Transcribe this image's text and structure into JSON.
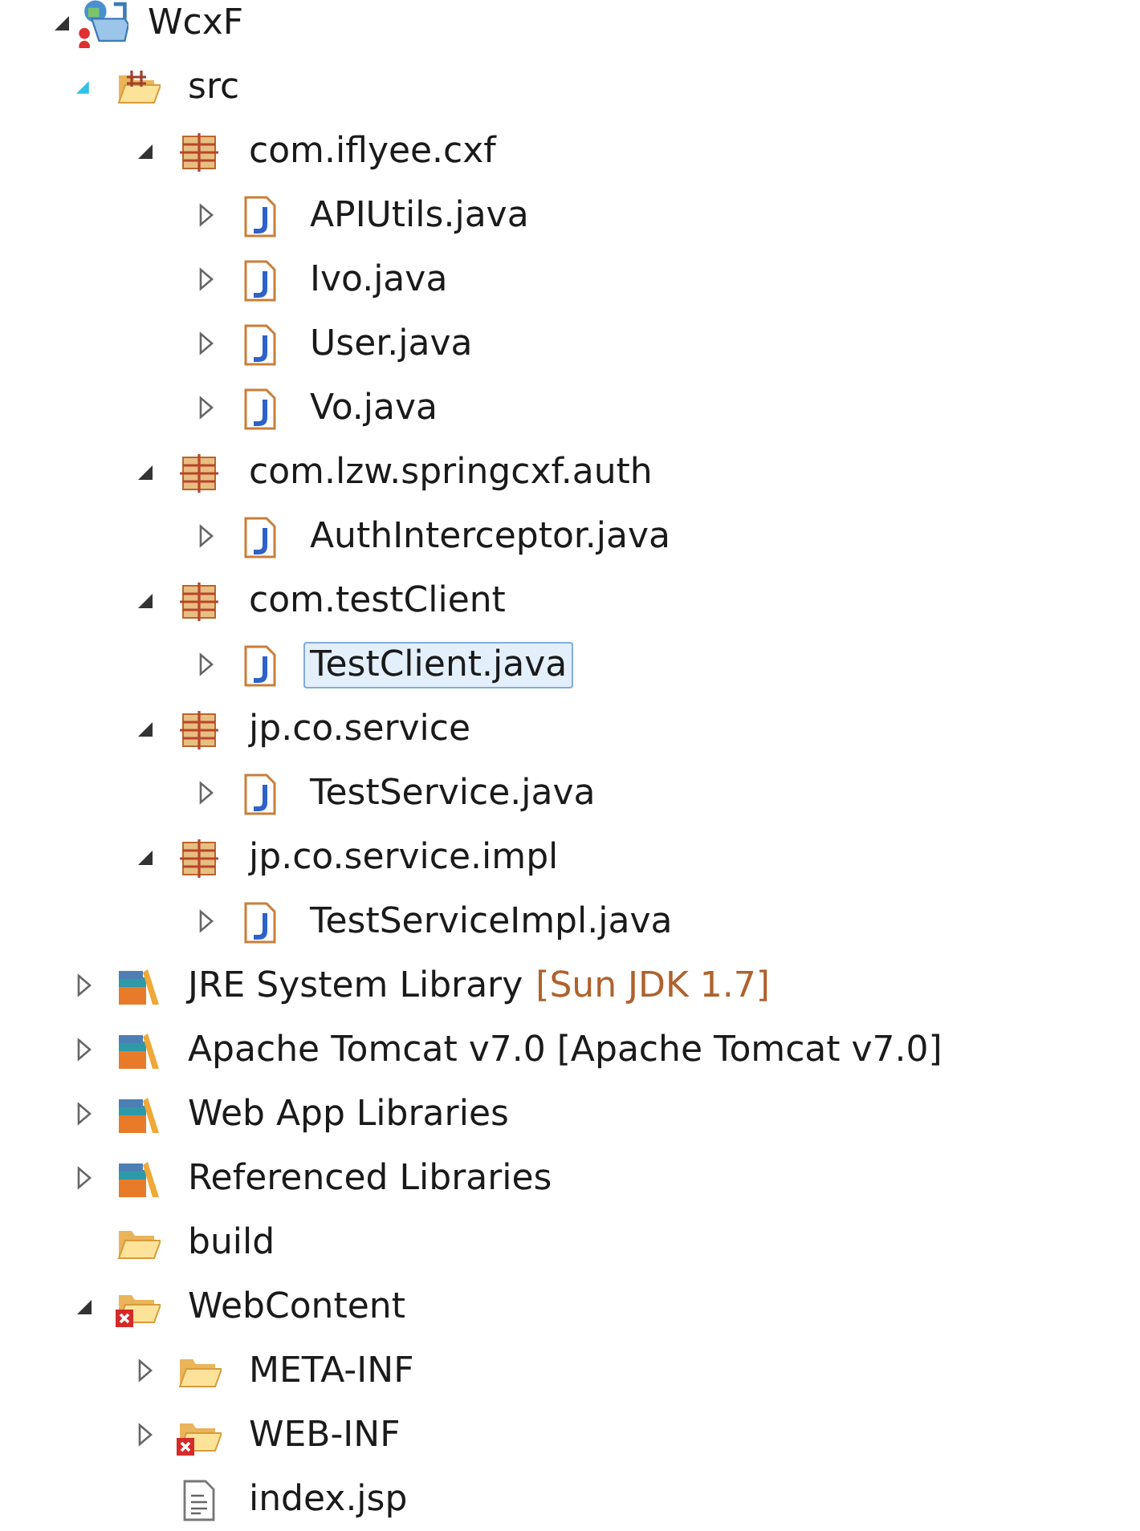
{
  "tree": [
    {
      "kind": "project",
      "label": "WcxF",
      "expanded": true,
      "selected": false,
      "children": [
        {
          "kind": "source-folder",
          "label": "src",
          "expanded": true,
          "hovered": true,
          "selected": false,
          "children": [
            {
              "kind": "package",
              "label": "com.iflyee.cxf",
              "expanded": true,
              "selected": false,
              "children": [
                {
                  "kind": "java",
                  "label": "APIUtils.java",
                  "expanded": false,
                  "selected": false
                },
                {
                  "kind": "java",
                  "label": "Ivo.java",
                  "expanded": false,
                  "selected": false
                },
                {
                  "kind": "java",
                  "label": "User.java",
                  "expanded": false,
                  "selected": false
                },
                {
                  "kind": "java",
                  "label": "Vo.java",
                  "expanded": false,
                  "selected": false
                }
              ]
            },
            {
              "kind": "package",
              "label": "com.lzw.springcxf.auth",
              "expanded": true,
              "selected": false,
              "children": [
                {
                  "kind": "java",
                  "label": "AuthInterceptor.java",
                  "expanded": false,
                  "selected": false
                }
              ]
            },
            {
              "kind": "package",
              "label": "com.testClient",
              "expanded": true,
              "selected": false,
              "children": [
                {
                  "kind": "java",
                  "label": "TestClient.java",
                  "expanded": false,
                  "selected": true
                }
              ]
            },
            {
              "kind": "package",
              "label": "jp.co.service",
              "expanded": true,
              "selected": false,
              "children": [
                {
                  "kind": "java",
                  "label": "TestService.java",
                  "expanded": false,
                  "selected": false
                }
              ]
            },
            {
              "kind": "package",
              "label": "jp.co.service.impl",
              "expanded": true,
              "selected": false,
              "children": [
                {
                  "kind": "java",
                  "label": "TestServiceImpl.java",
                  "expanded": false,
                  "selected": false
                }
              ]
            }
          ]
        },
        {
          "kind": "library",
          "label": "JRE System Library",
          "suffix": "[Sun JDK 1.7]",
          "expanded": false,
          "selected": false
        },
        {
          "kind": "library",
          "label": "Apache Tomcat v7.0 [Apache Tomcat v7.0]",
          "expanded": false,
          "selected": false
        },
        {
          "kind": "library",
          "label": "Web App Libraries",
          "expanded": false,
          "selected": false
        },
        {
          "kind": "library",
          "label": "Referenced Libraries",
          "expanded": false,
          "selected": false
        },
        {
          "kind": "folder",
          "label": "build",
          "selected": false
        },
        {
          "kind": "error-folder",
          "label": "WebContent",
          "expanded": true,
          "selected": false,
          "children": [
            {
              "kind": "folder",
              "label": "META-INF",
              "expanded": false,
              "selected": false
            },
            {
              "kind": "error-folder",
              "label": "WEB-INF",
              "expanded": false,
              "selected": false
            },
            {
              "kind": "file",
              "label": "index.jsp",
              "selected": false
            }
          ]
        }
      ]
    }
  ]
}
